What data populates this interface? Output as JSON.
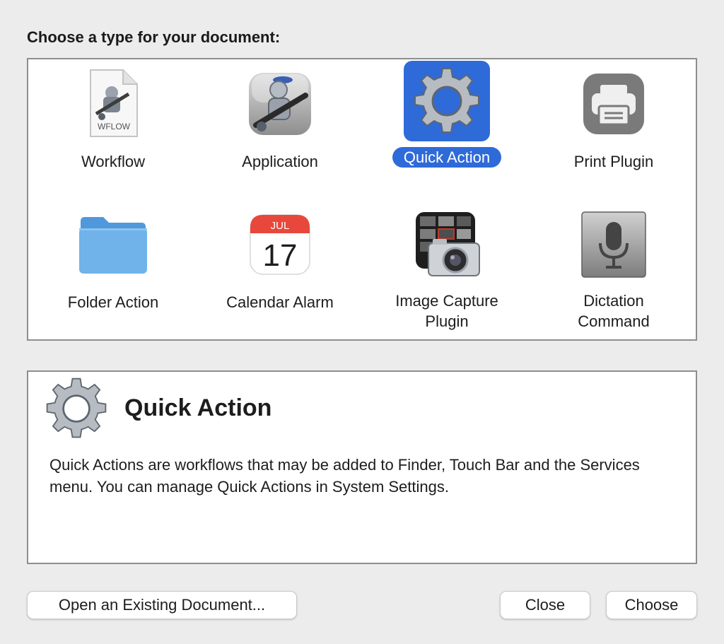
{
  "prompt": "Choose a type for your document:",
  "types": [
    {
      "label": "Workflow",
      "icon": "workflow-file-icon",
      "badge": "WFLOW",
      "selected": false
    },
    {
      "label": "Application",
      "icon": "automator-robot-icon",
      "selected": false
    },
    {
      "label": "Quick Action",
      "icon": "gear-icon",
      "selected": true
    },
    {
      "label": "Print Plugin",
      "icon": "printer-icon",
      "selected": false
    },
    {
      "label": "Folder Action",
      "icon": "folder-icon",
      "selected": false
    },
    {
      "label": "Calendar Alarm",
      "icon": "calendar-icon",
      "month": "JUL",
      "day": "17",
      "selected": false
    },
    {
      "label": "Image Capture\nPlugin",
      "icon": "camera-icon",
      "selected": false
    },
    {
      "label": "Dictation\nCommand",
      "icon": "microphone-icon",
      "selected": false
    }
  ],
  "description": {
    "icon": "gear-icon",
    "title": "Quick Action",
    "text": "Quick Actions are workflows that may be added to Finder, Touch Bar and the Services menu. You can manage Quick Actions in System Settings."
  },
  "buttons": {
    "open_existing": "Open an Existing Document...",
    "close": "Close",
    "choose": "Choose"
  },
  "colors": {
    "selection": "#2f6ad9",
    "folder": "#6fb3ea",
    "calendar_red": "#e8483c"
  }
}
